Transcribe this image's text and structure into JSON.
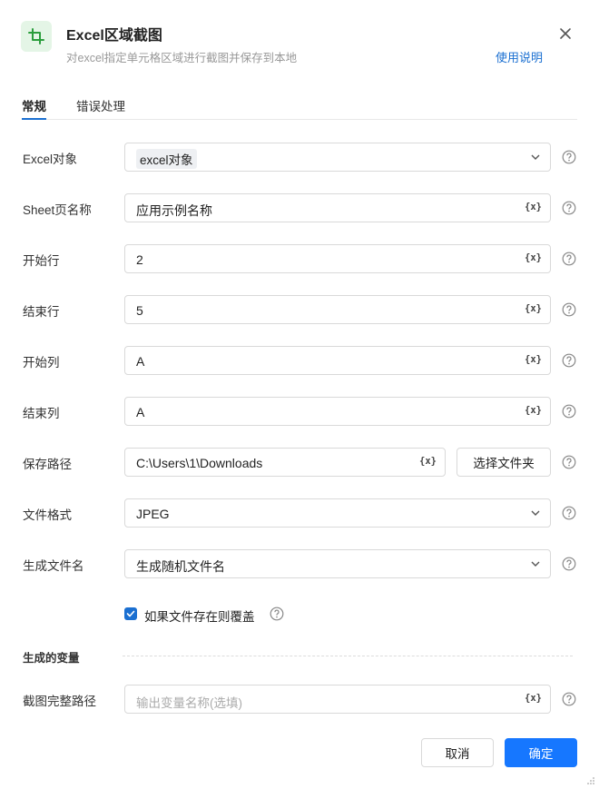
{
  "header": {
    "title": "Excel区域截图",
    "subtitle": "对excel指定单元格区域进行截图并保存到本地",
    "help_link": "使用说明",
    "icon": "crop-icon",
    "close_icon": "close-icon"
  },
  "tabs": [
    {
      "label": "常规",
      "active": true
    },
    {
      "label": "错误处理",
      "active": false
    }
  ],
  "fields": {
    "excel_object": {
      "label": "Excel对象",
      "value": "excel对象",
      "type": "select"
    },
    "sheet_name": {
      "label": "Sheet页名称",
      "value": "应用示例名称",
      "type": "text-var"
    },
    "start_row": {
      "label": "开始行",
      "value": "2",
      "type": "text-var"
    },
    "end_row": {
      "label": "结束行",
      "value": "5",
      "type": "text-var"
    },
    "start_col": {
      "label": "开始列",
      "value": "A",
      "type": "text-var"
    },
    "end_col": {
      "label": "结束列",
      "value": "A",
      "type": "text-var"
    },
    "save_path": {
      "label": "保存路径",
      "value": "C:\\Users\\1\\Downloads",
      "type": "text-var",
      "button_label": "选择文件夹"
    },
    "file_format": {
      "label": "文件格式",
      "value": "JPEG",
      "type": "select"
    },
    "file_name": {
      "label": "生成文件名",
      "value": "生成随机文件名",
      "type": "select"
    }
  },
  "var_icon_text": "{x}",
  "overwrite": {
    "label": "如果文件存在则覆盖",
    "checked": true
  },
  "output_section": {
    "title": "生成的变量",
    "screenshot_path": {
      "label": "截图完整路径",
      "placeholder": "输出变量名称(选填)",
      "value": ""
    }
  },
  "footer": {
    "cancel_label": "取消",
    "confirm_label": "确定"
  },
  "colors": {
    "accent": "#1677ff",
    "link": "#1a6fd1",
    "icon_bg": "#e4f5e6",
    "icon_fg": "#2a9d3c"
  }
}
